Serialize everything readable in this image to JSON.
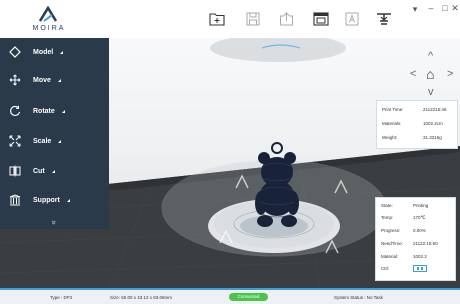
{
  "app": {
    "logo_text": "MOIRA"
  },
  "colors": {
    "accent": "#3aa0d8",
    "panel": "#2b3a4a",
    "connected": "#4cc44c"
  },
  "toolbar": {
    "icons": [
      "folder-open-icon",
      "save-icon",
      "export-icon",
      "slice-icon",
      "text-icon",
      "print-icon"
    ]
  },
  "window": {
    "min": "–",
    "max": "□",
    "close": "✕",
    "menu": "▾"
  },
  "sidebar": {
    "items": [
      {
        "label": "Model",
        "icon": "cube-icon"
      },
      {
        "label": "Move",
        "icon": "move-icon"
      },
      {
        "label": "Rotate",
        "icon": "rotate-icon"
      },
      {
        "label": "Scale",
        "icon": "scale-icon"
      },
      {
        "label": "Cut",
        "icon": "cut-icon"
      },
      {
        "label": "Support",
        "icon": "support-icon"
      }
    ],
    "more": "»"
  },
  "nav": {
    "up": "^",
    "down": "v",
    "left": "<",
    "right": ">",
    "home": "⌂"
  },
  "print_info": {
    "rows": [
      {
        "label": "Print Time:",
        "value": "2112215:46"
      },
      {
        "label": "Materials:",
        "value": "1002.2cm"
      },
      {
        "label": "Weight:",
        "value": "31.3216g"
      }
    ]
  },
  "status_panel": {
    "rows": [
      {
        "label": "State:",
        "value": "Printing"
      },
      {
        "label": "Temp:",
        "value": "170℃"
      },
      {
        "label": "Progress:",
        "value": "0.00%"
      },
      {
        "label": "NeedTime:",
        "value": "21122:15:60"
      },
      {
        "label": "Material:",
        "value": "1002.2"
      },
      {
        "label": "Ctrl:",
        "value": ""
      }
    ]
  },
  "statusbar": {
    "type": "Type : DF3",
    "size": "Size: 50.00 x 43.12 x 83.06mm",
    "connection": "Connected",
    "system": "System Status : No Task"
  }
}
